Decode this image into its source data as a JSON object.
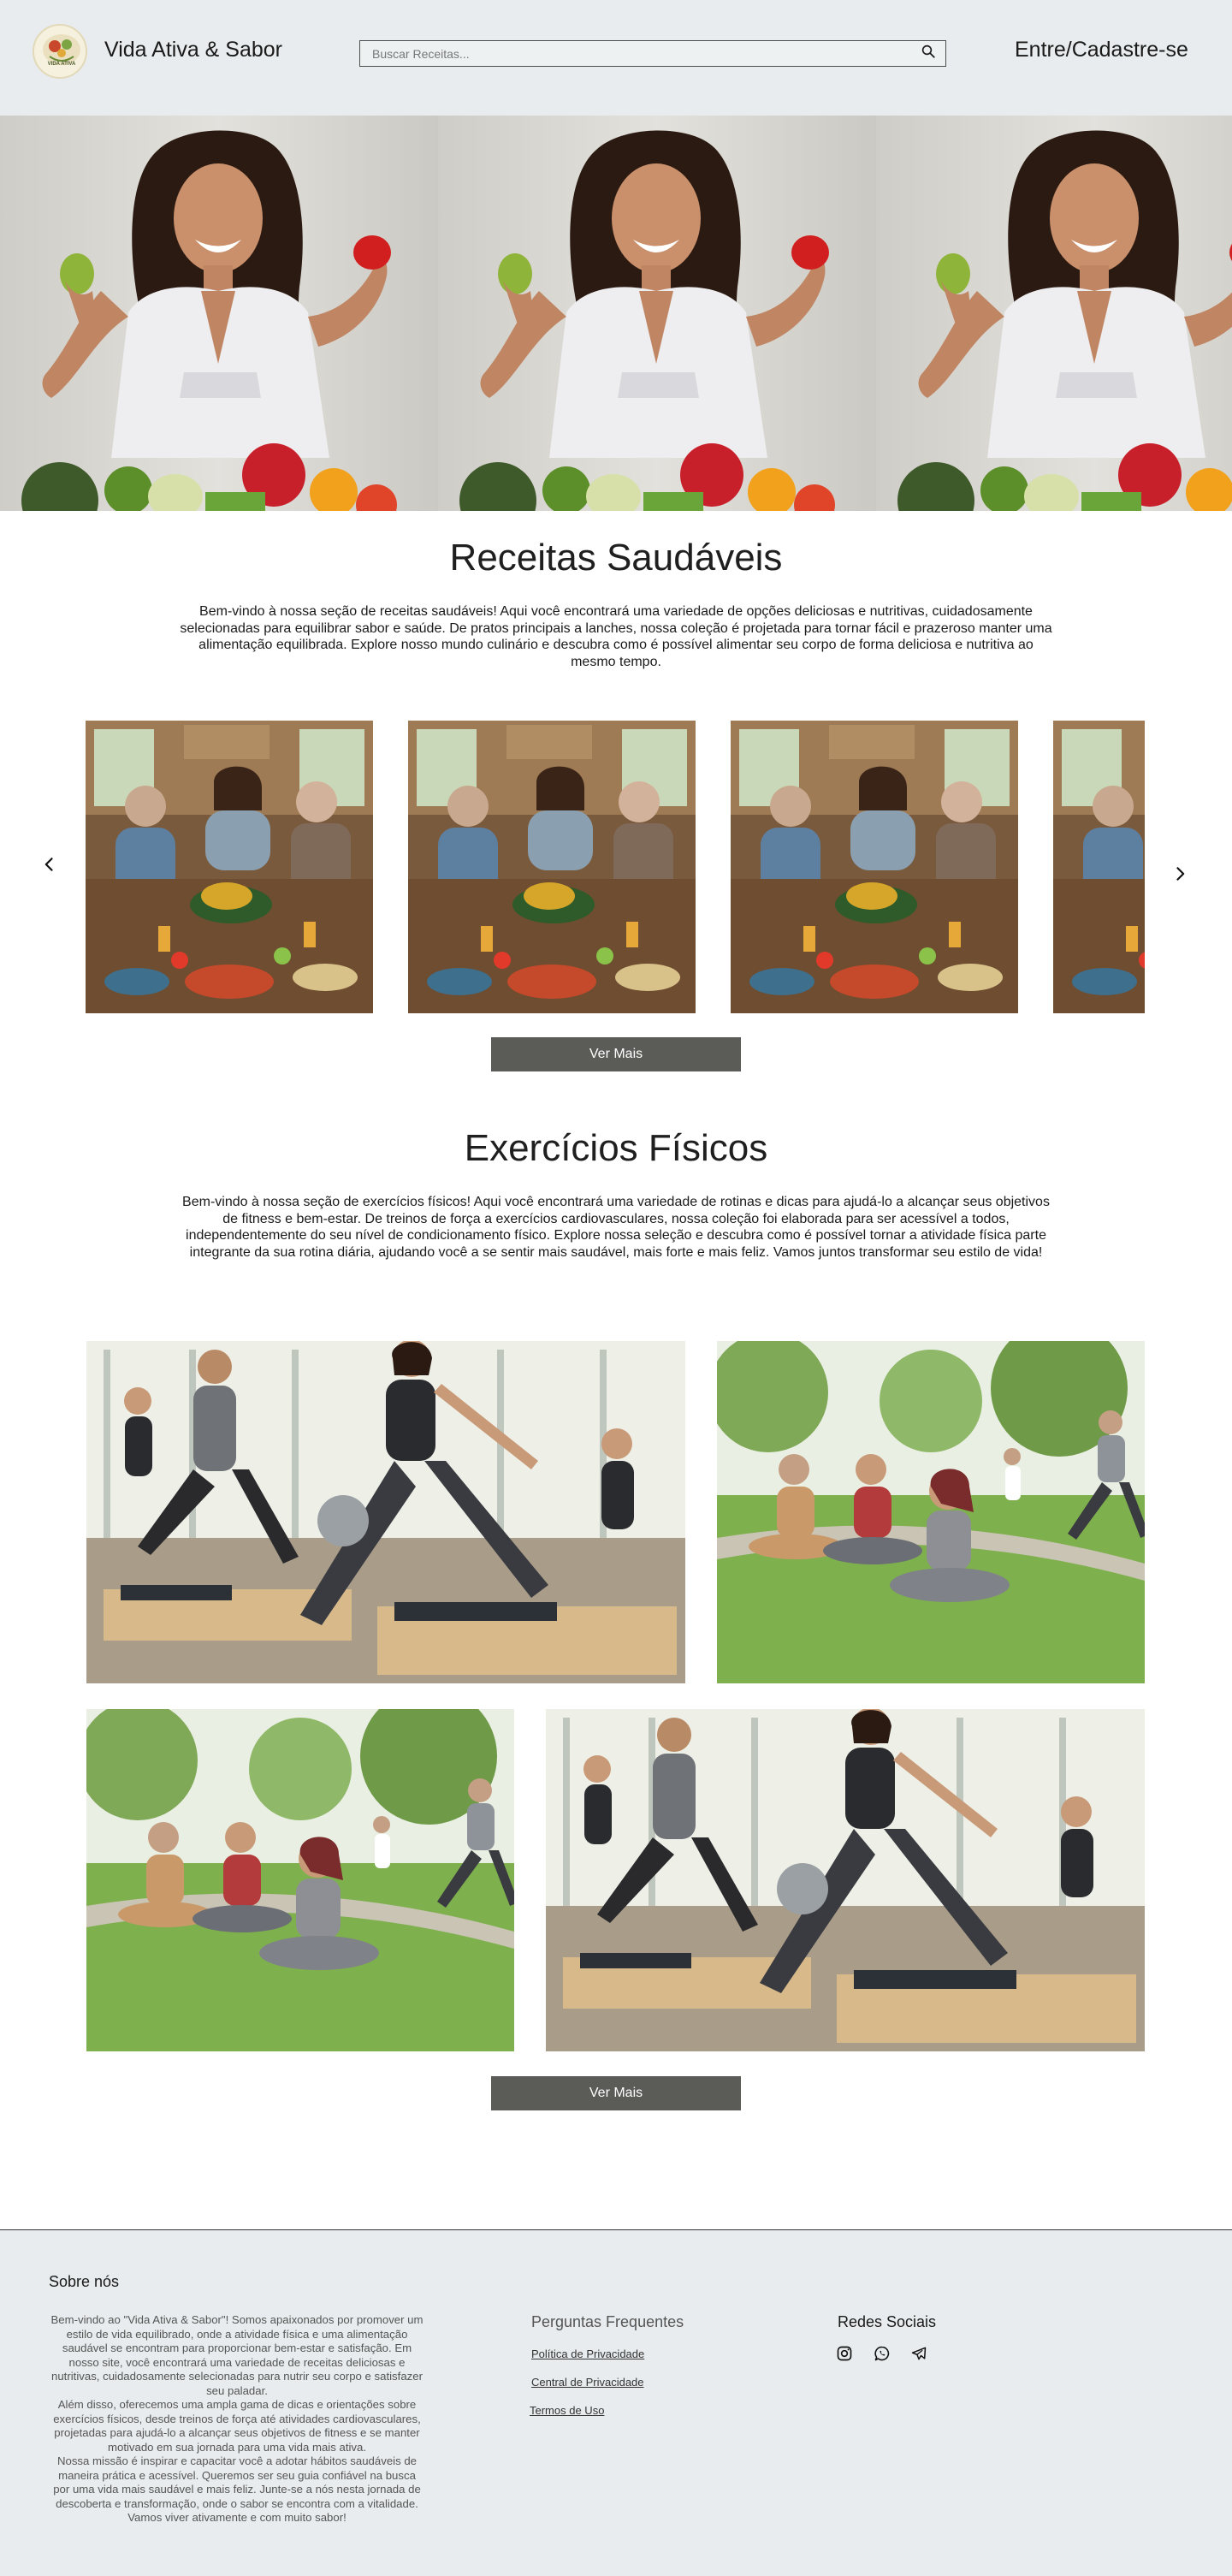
{
  "header": {
    "brand": "Vida Ativa & Sabor",
    "logo_text": "VIDA ATIVA",
    "search_placeholder": "Buscar Receitas...",
    "login": "Entre/Cadastre-se"
  },
  "recipes": {
    "title": "Receitas Saudáveis",
    "intro": "Bem-vindo à nossa seção de receitas saudáveis! Aqui você encontrará uma variedade de opções deliciosas e nutritivas, cuidadosamente selecionadas para equilibrar sabor e saúde. De pratos principais a lanches, nossa coleção é projetada para tornar fácil e prazeroso manter uma alimentação equilibrada. Explore nosso mundo culinário e descubra como é possível alimentar seu corpo de forma deliciosa e nutritiva ao mesmo tempo.",
    "more_label": "Ver Mais"
  },
  "exercises": {
    "title": "Exercícios Físicos",
    "intro": "Bem-vindo à nossa seção de exercícios físicos! Aqui você encontrará uma variedade de rotinas e dicas para ajudá-lo a alcançar seus objetivos de fitness e bem-estar. De treinos de força a exercícios cardiovasculares, nossa coleção foi elaborada para ser acessível a todos, independentemente do seu nível de condicionamento físico. Explore nossa seleção e descubra como é possível tornar a atividade física parte integrante da sua rotina diária, ajudando você a se sentir mais saudável, mais forte e mais feliz. Vamos juntos transformar seu estilo de vida!",
    "more_label": "Ver Mais"
  },
  "footer": {
    "about_title": "Sobre nós",
    "about_p1": "Bem-vindo ao \"Vida Ativa & Sabor\"! Somos apaixonados por promover um estilo de vida equilibrado, onde a atividade física e uma alimentação saudável se encontram para proporcionar bem-estar e satisfação. Em nosso site, você encontrará uma variedade de receitas deliciosas e nutritivas, cuidadosamente selecionadas para nutrir seu corpo e satisfazer seu paladar.",
    "about_p2": "Além disso, oferecemos uma ampla gama de dicas e orientações sobre exercícios físicos, desde treinos de força até atividades cardiovasculares, projetadas para ajudá-lo a alcançar seus objetivos de fitness e se manter motivado em sua jornada para uma vida mais ativa.",
    "about_p3": "Nossa missão é inspirar e capacitar você a adotar hábitos saudáveis de maneira prática e acessível. Queremos ser seu guia confiável na busca por uma vida mais saudável e mais feliz. Junte-se a nós nesta jornada de descoberta e transformação, onde o sabor se encontra com a vitalidade. Vamos viver ativamente e com muito sabor!",
    "faq_title": "Perguntas Frequentes",
    "links": [
      "Política de Privacidade",
      "Central de Privacidade",
      "Termos de Uso"
    ],
    "social_title": "Redes Sociais"
  },
  "icons": {
    "search": "search-icon",
    "prev": "chevron-left-icon",
    "next": "chevron-right-icon",
    "social": [
      "instagram-icon",
      "whatsapp-icon",
      "telegram-icon"
    ]
  }
}
